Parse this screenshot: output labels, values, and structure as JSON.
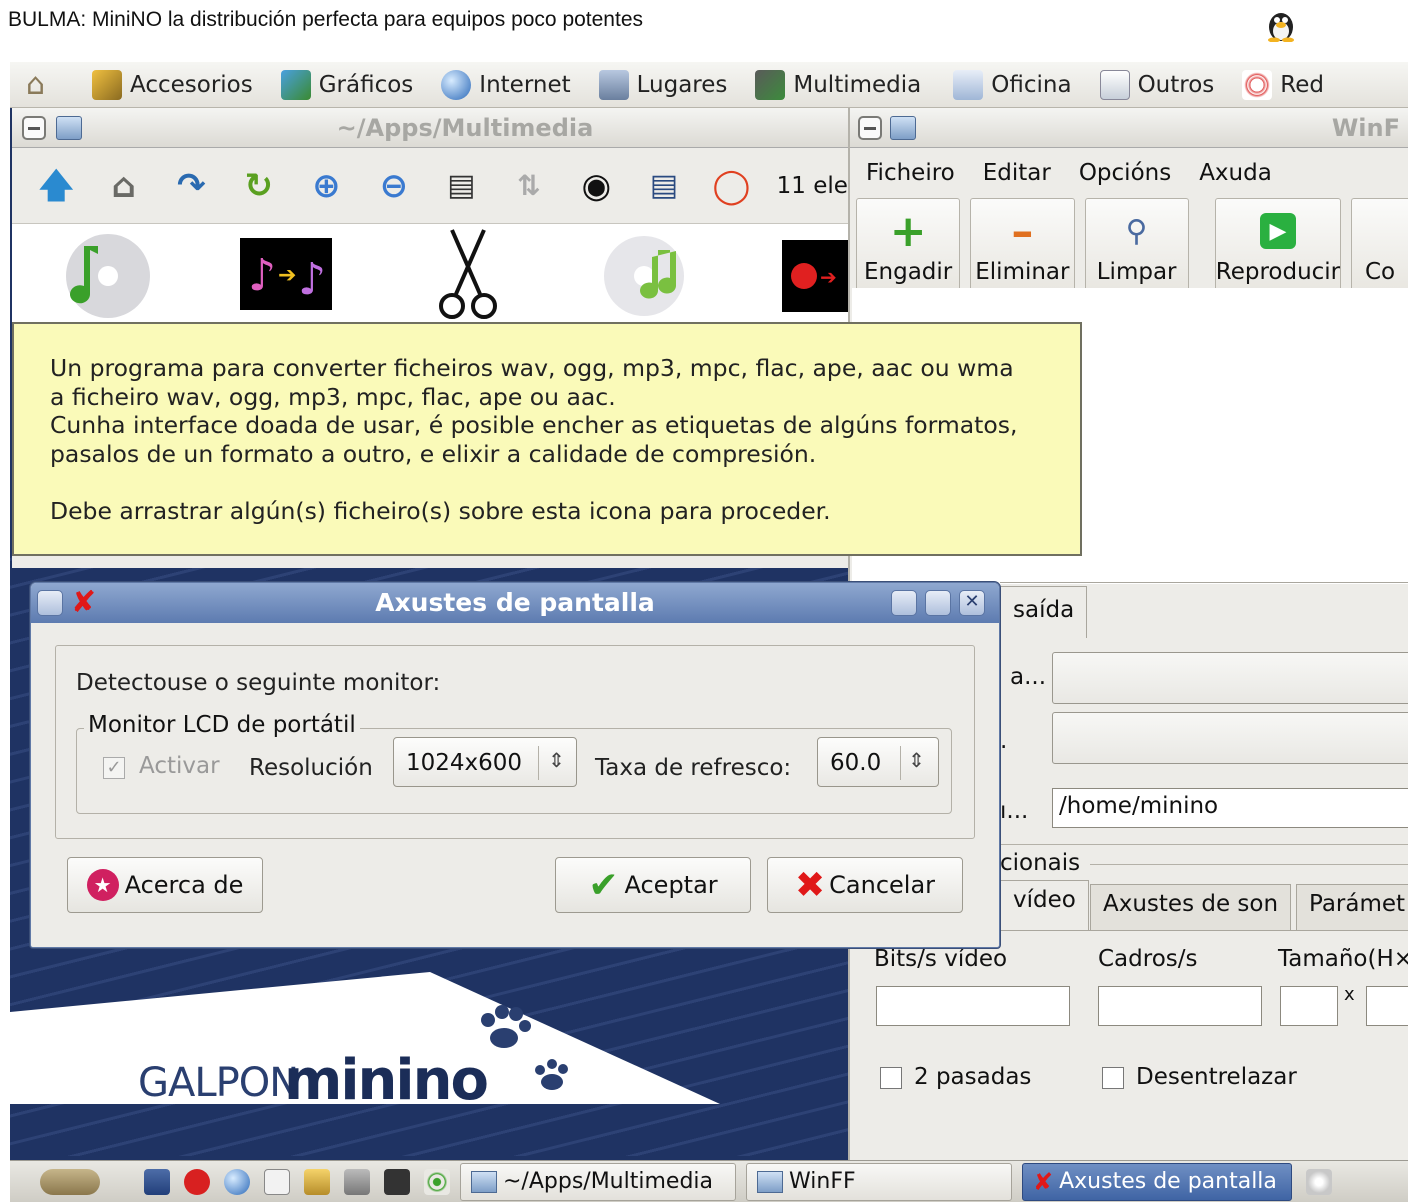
{
  "page_title": "BULMA: MiniNO la distribución perfecta para equipos poco potentes",
  "menubar": {
    "items": [
      "Accesorios",
      "Gráficos",
      "Internet",
      "Lugares",
      "Multimedia",
      "Oficina",
      "Outros",
      "Red"
    ]
  },
  "file_manager": {
    "title": "~/Apps/Multimedia",
    "item_count": "11 ele"
  },
  "tooltip": {
    "lines": [
      "Un programa para converter ficheiros wav, ogg, mp3, mpc, flac, ape, aac ou wma",
      "a ficheiro wav, ogg, mp3, mpc, flac, ape ou aac.",
      "Cunha interface doada de usar, é posible encher as etiquetas de algúns formatos,",
      "pasalos de un formato a outro, e elixir a calidade de compresión.",
      "",
      "Debe arrastrar algún(s) ficheiro(s) sobre esta icona para proceder."
    ]
  },
  "winff": {
    "title": "WinF",
    "menu": [
      "Ficheiro",
      "Editar",
      "Opcións",
      "Axuda"
    ],
    "toolbar": [
      "Engadir",
      "Eliminar",
      "Limpar",
      "Reproducir",
      "Co"
    ],
    "tab_output": "saída",
    "label_a": "a...",
    "label_dot": ".",
    "label_h": "ı...",
    "output_path": "/home/minino",
    "section_additional": "cionais",
    "tabs": [
      "vídeo",
      "Axustes de son",
      "Parámet"
    ],
    "fields": [
      "Bits/s vídeo",
      "Cadros/s",
      "Tamaño(H×"
    ],
    "x_label": "x",
    "check_two_pass": "2 pasadas",
    "check_deinterlace": "Desentrelazar"
  },
  "wallpaper": {
    "logo_galpon": "GALPON",
    "logo_minino": "minino"
  },
  "dialog": {
    "title": "Axustes de pantalla",
    "detected_text": "Detectouse o seguinte monitor:",
    "monitor_group": "Monitor LCD de portátil",
    "activate_label": "Activar",
    "resolution_label": "Resolución",
    "resolution_value": "1024x600",
    "refresh_label": "Taxa de refresco:",
    "refresh_value": "60.0",
    "about_button": "Acerca de",
    "ok_button": "Aceptar",
    "cancel_button": "Cancelar"
  },
  "taskbar": {
    "tasks": [
      "~/Apps/Multimedia",
      "WinFF",
      "Axustes de pantalla"
    ]
  },
  "colors": {
    "desktop_bg": "#1f3363",
    "tooltip_bg": "#fafab9",
    "dialog_title": "#5d7bb0",
    "accept_green": "#3aa02a",
    "cancel_red": "#e01818"
  }
}
